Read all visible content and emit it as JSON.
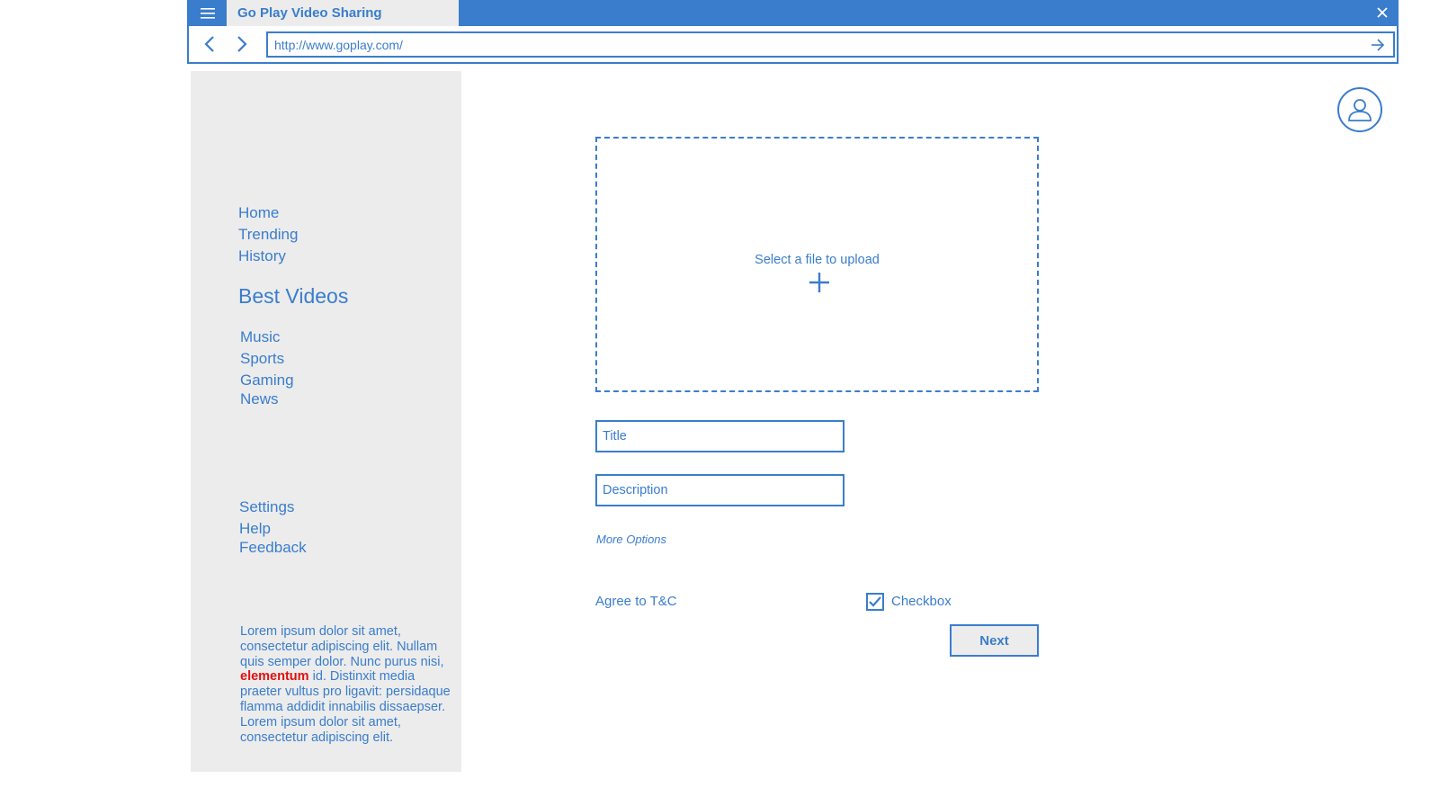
{
  "colors": {
    "accent": "#3a7dcc",
    "panel": "#ececec",
    "highlight": "#e01010"
  },
  "browser": {
    "tab_title": "Go Play Video Sharing",
    "url": "http://www.goplay.com/",
    "icons": {
      "menu": "hamburger-icon",
      "close": "close-icon",
      "back": "chevron-left-icon",
      "forward": "chevron-right-icon",
      "go": "arrow-right-icon"
    }
  },
  "sidebar": {
    "primary_nav": [
      "Home",
      "Trending",
      "History"
    ],
    "section_heading": "Best Videos",
    "categories": [
      "Music",
      "Sports",
      "Gaming",
      "News"
    ],
    "secondary_nav": [
      "Settings",
      "Help",
      "Feedback"
    ],
    "lorem": {
      "before": "Lorem ipsum dolor sit amet, consectetur adipiscing elit. Nullam quis semper dolor. Nunc purus nisi, ",
      "highlight": "elementum",
      "after": " id. Distinxit  media praeter vultus pro ligavit: persidaque flamma addidit innabilis dissaepser. Lorem ipsum dolor sit amet, consectetur adipiscing elit."
    }
  },
  "upload": {
    "drop_label": "Select a file to upload",
    "icon": "plus-icon",
    "title_placeholder": "Title",
    "description_placeholder": "Description",
    "more_options": "More Options",
    "agree_label": "Agree to T&C",
    "checkbox_label": "Checkbox",
    "checkbox_checked": true,
    "next_label": "Next"
  },
  "header": {
    "avatar_icon": "user-icon"
  }
}
